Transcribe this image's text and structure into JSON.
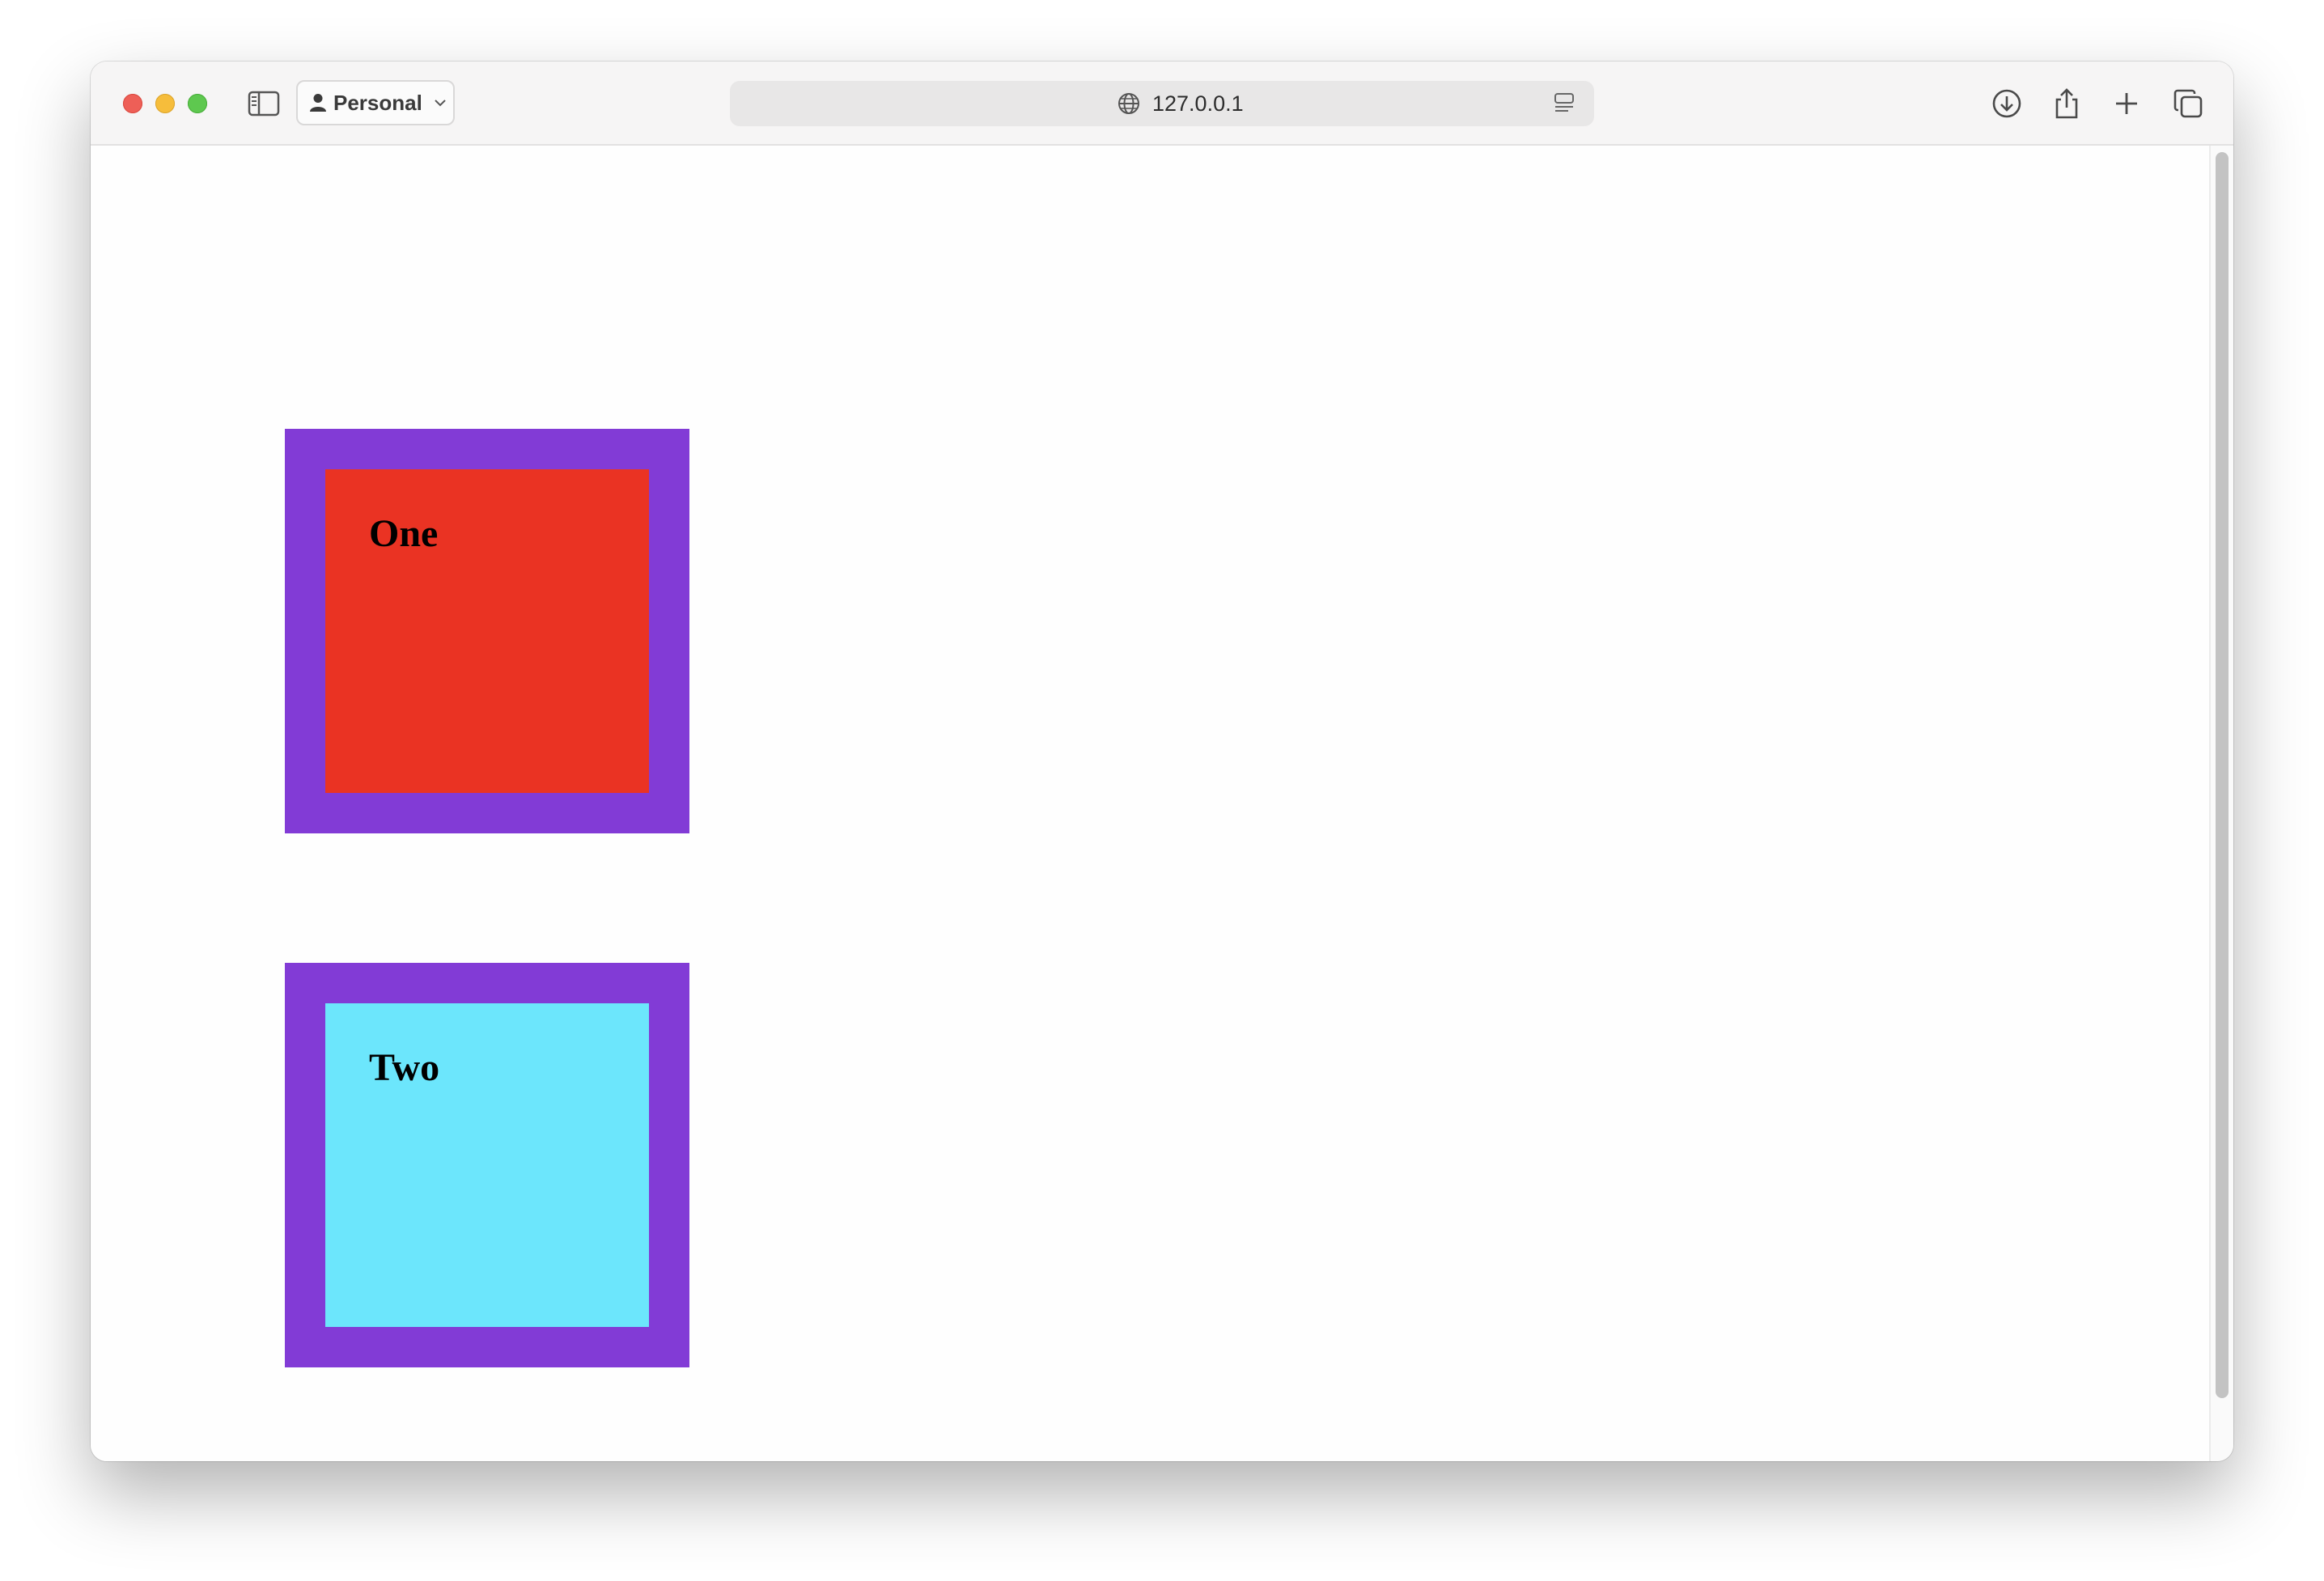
{
  "browser": {
    "profile_label": "Personal",
    "address": "127.0.0.1"
  },
  "colors": {
    "frame": "#823bd6",
    "box_one_fill": "#ea3323",
    "box_two_fill": "#6ce6fc"
  },
  "icons": {
    "toolbar_left": [
      "close-icon",
      "minimize-icon",
      "maximize-icon",
      "sidebar-icon",
      "person-icon",
      "chevron-down-icon"
    ],
    "address": [
      "globe-icon",
      "reader-icon"
    ],
    "toolbar_right": [
      "download-icon",
      "share-icon",
      "plus-icon",
      "tabs-overview-icon"
    ]
  },
  "page": {
    "boxes": [
      {
        "label": "One"
      },
      {
        "label": "Two"
      }
    ]
  }
}
